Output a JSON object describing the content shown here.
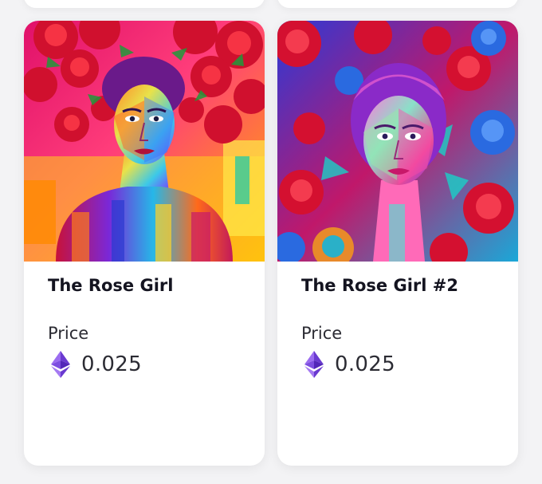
{
  "items": [
    {
      "title": "The Rose Girl",
      "price_label": "Price",
      "price_value": "0.025",
      "currency_icon": "ethereum-icon"
    },
    {
      "title": "The Rose Girl #2",
      "price_label": "Price",
      "price_value": "0.025",
      "currency_icon": "ethereum-icon"
    }
  ],
  "colors": {
    "page_background": "#f3f3f5",
    "card_background": "#ffffff",
    "title_text": "#141420",
    "body_text": "#2b2b33",
    "ethereum_purple": "#7b4de2"
  }
}
